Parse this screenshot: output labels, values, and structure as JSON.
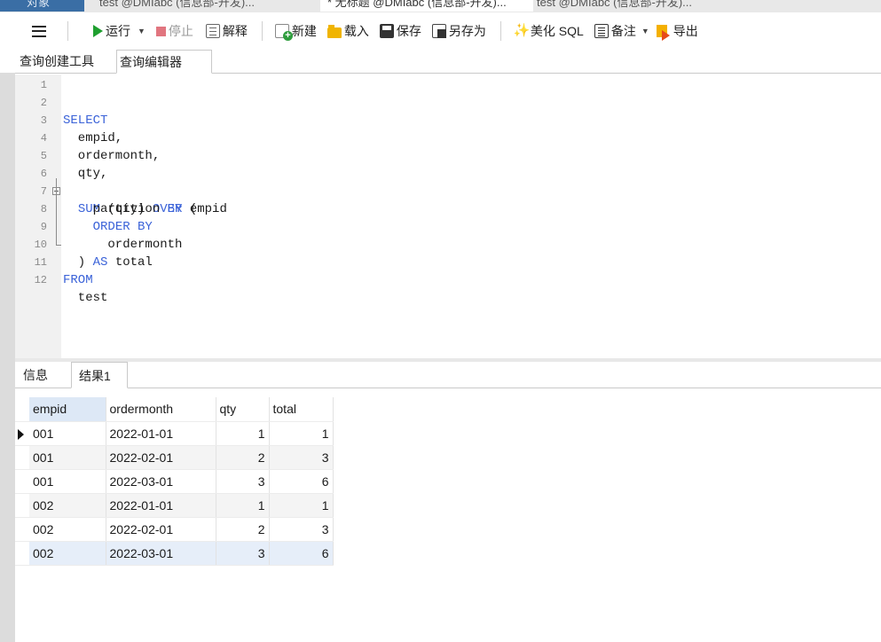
{
  "doc_tabs": [
    {
      "label": "对象"
    },
    {
      "label": "test @DMIabc (信息部-开发)..."
    },
    {
      "label": "* 无标题 @DMIabc (信息部-开发)..."
    },
    {
      "label": "test @DMIabc (信息部-开发)..."
    }
  ],
  "toolbar": {
    "run": "运行",
    "stop": "停止",
    "explain": "解释",
    "new": "新建",
    "load": "载入",
    "save": "保存",
    "saveas": "另存为",
    "beautify": "美化 SQL",
    "note": "备注",
    "export": "导出"
  },
  "query_tabs": [
    {
      "label": "查询创建工具"
    },
    {
      "label": "查询编辑器"
    }
  ],
  "editor": {
    "line_numbers": [
      "1",
      "2",
      "3",
      "4",
      "5",
      "6",
      "7",
      "8",
      "9",
      "10",
      "11",
      "12"
    ]
  },
  "result_tabs": [
    {
      "label": "信息"
    },
    {
      "label": "结果1"
    }
  ],
  "grid": {
    "columns": [
      "empid",
      "ordermonth",
      "qty",
      "total"
    ],
    "rows": [
      [
        "001",
        "2022-01-01",
        "1",
        "1"
      ],
      [
        "001",
        "2022-02-01",
        "2",
        "3"
      ],
      [
        "001",
        "2022-03-01",
        "3",
        "6"
      ],
      [
        "002",
        "2022-01-01",
        "1",
        "1"
      ],
      [
        "002",
        "2022-02-01",
        "2",
        "3"
      ],
      [
        "002",
        "2022-03-01",
        "3",
        "6"
      ]
    ]
  }
}
